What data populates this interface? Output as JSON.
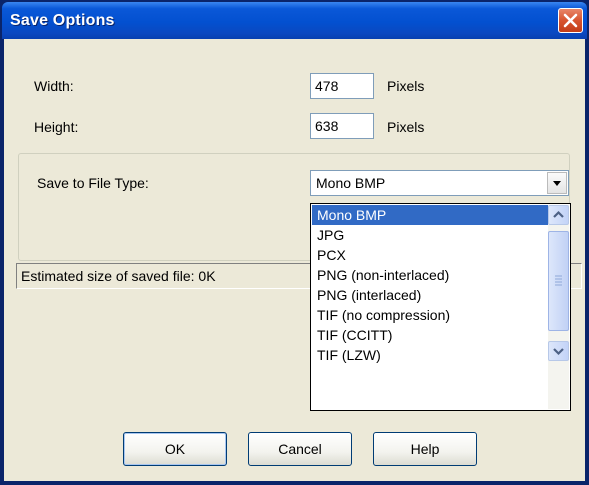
{
  "dialog": {
    "title": "Save Options"
  },
  "fields": {
    "width_label": "Width:",
    "width_value": "478",
    "width_unit": "Pixels",
    "height_label": "Height:",
    "height_value": "638",
    "height_unit": "Pixels"
  },
  "file_type": {
    "label": "Save to File Type:",
    "selected": "Mono BMP",
    "options": [
      "Mono BMP",
      "JPG",
      "PCX",
      "PNG (non-interlaced)",
      "PNG (interlaced)",
      "TIF (no compression)",
      "TIF (CCITT)",
      "TIF (LZW)"
    ]
  },
  "status": {
    "text": "Estimated size of saved file: 0K"
  },
  "buttons": {
    "ok": "OK",
    "cancel": "Cancel",
    "help": "Help"
  },
  "colors": {
    "title_bar": "#0350d0",
    "selection": "#316ac5",
    "close_button": "#d7542f",
    "dialog_face": "#ece9d8"
  }
}
